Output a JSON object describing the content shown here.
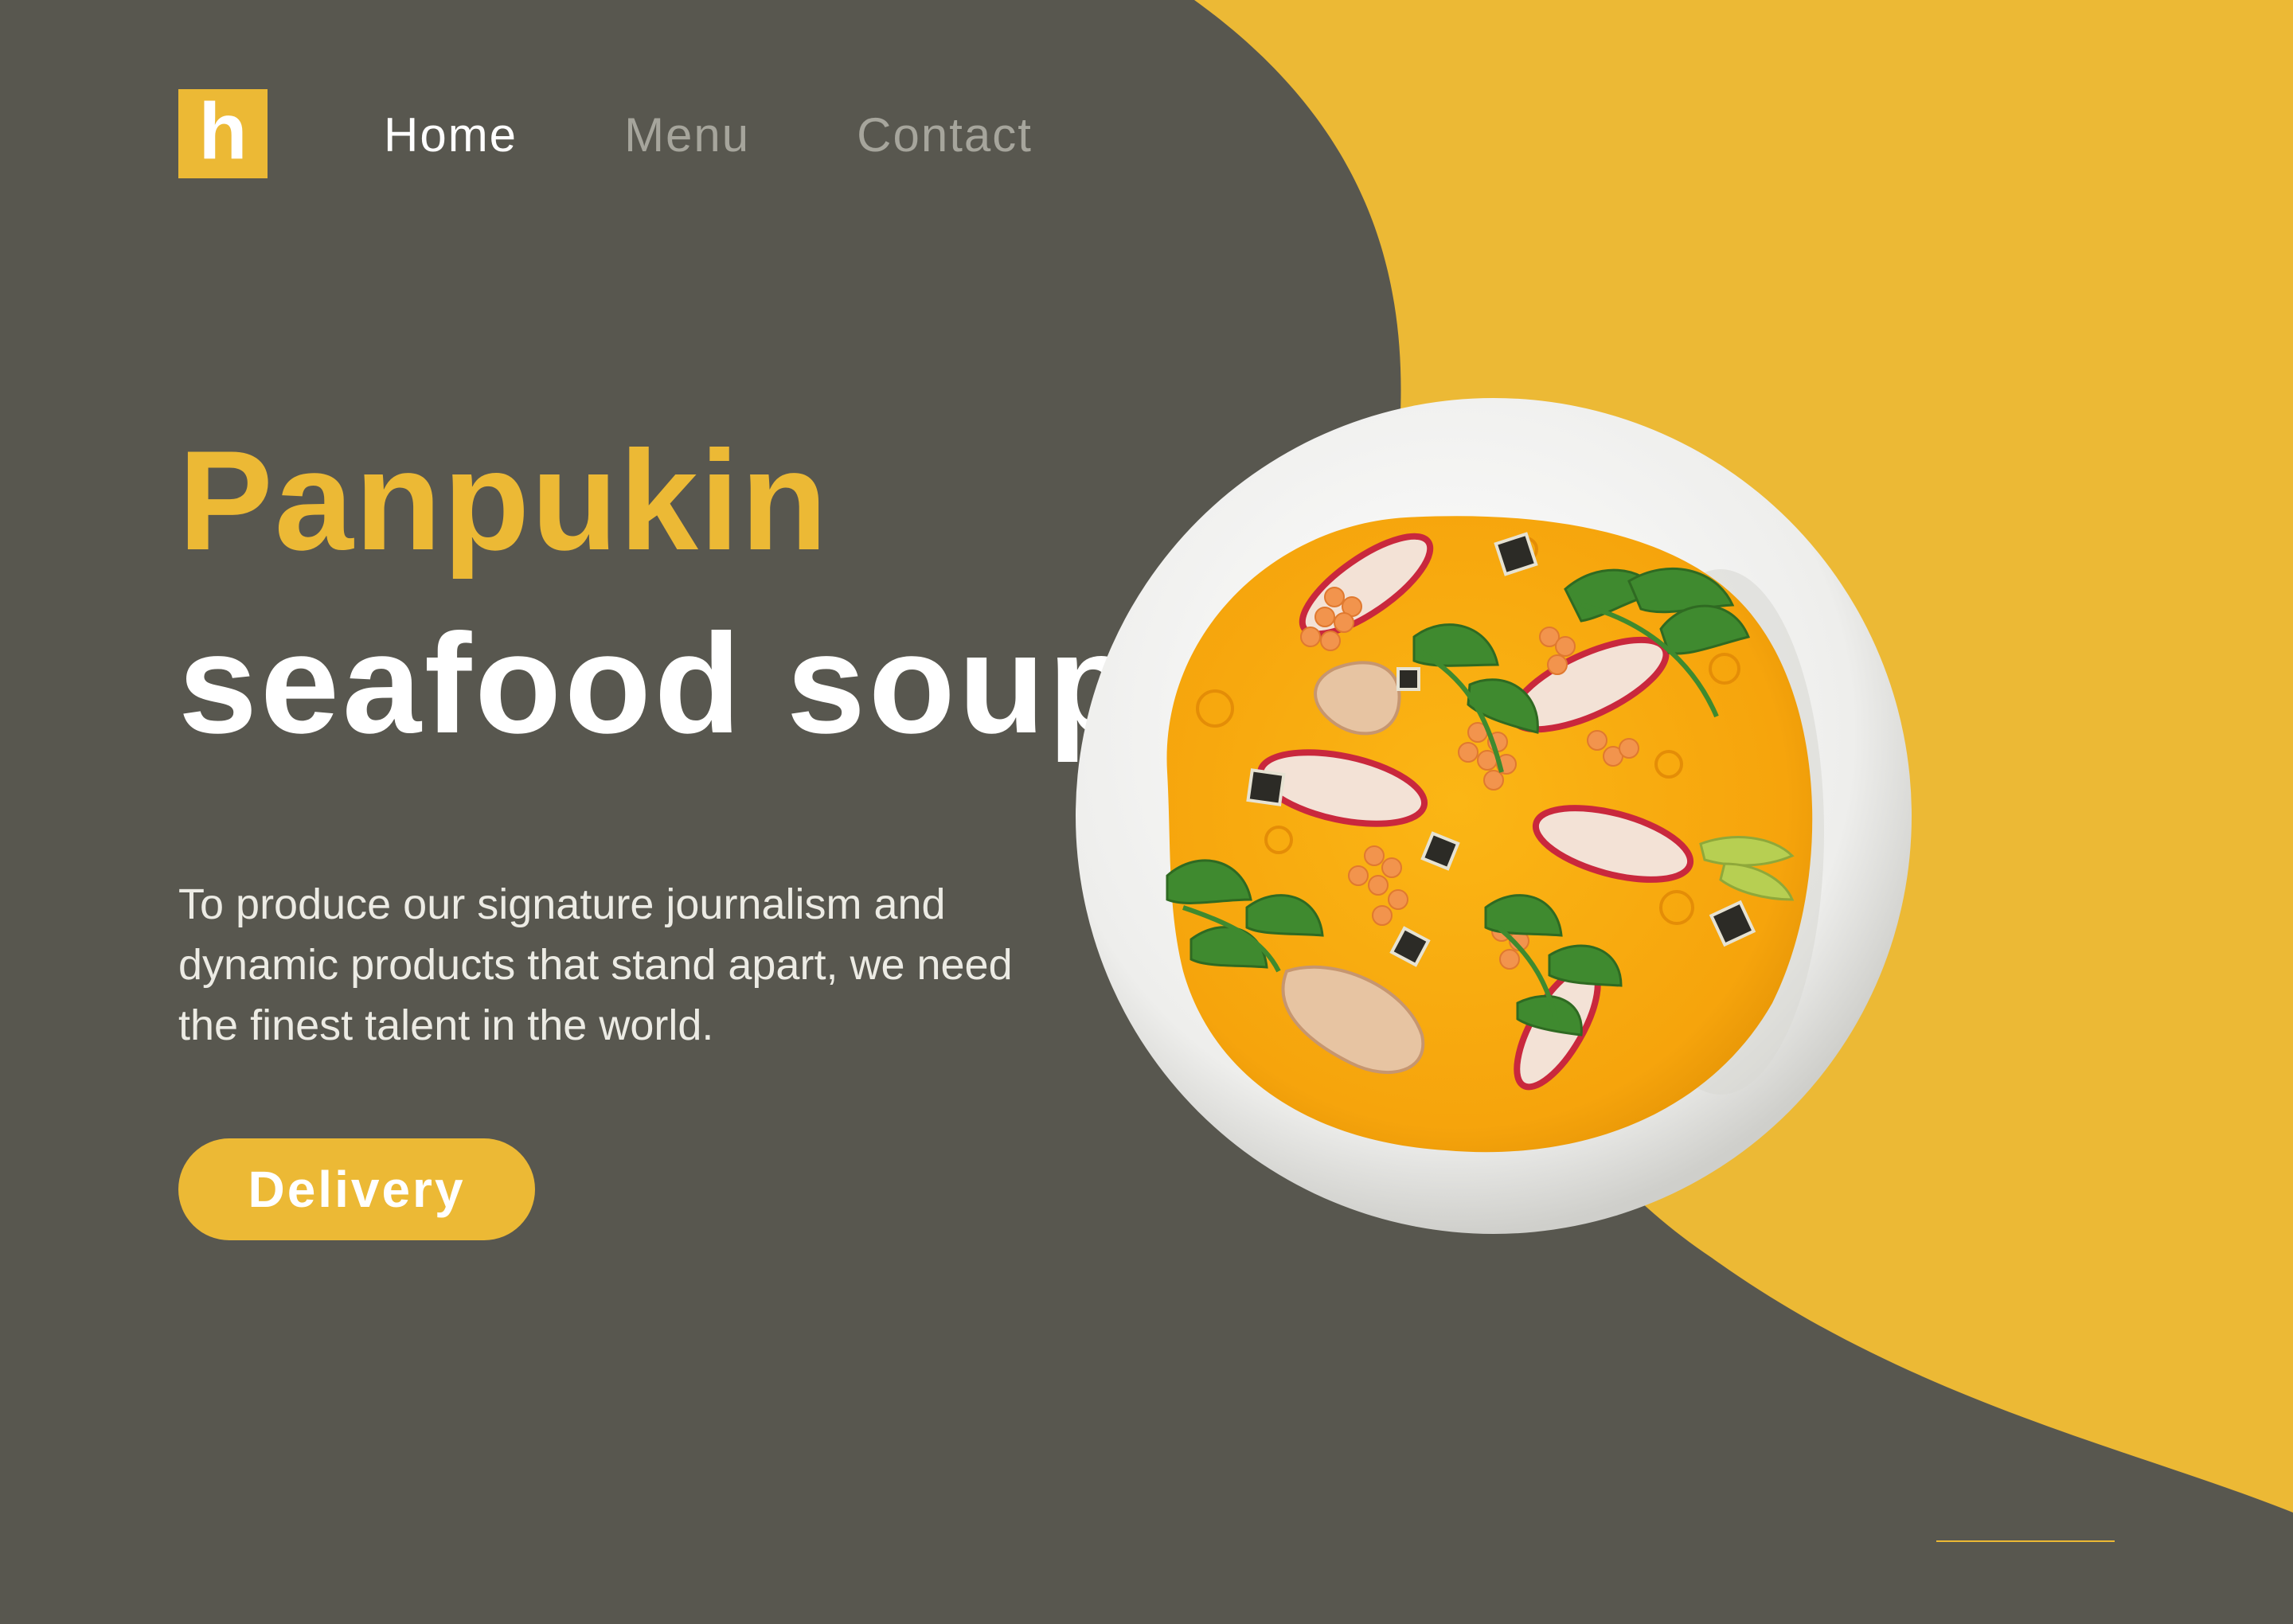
{
  "brand": {
    "logo_letter": "h"
  },
  "nav": {
    "items": [
      "Home",
      "Menu",
      "Contact"
    ],
    "active": "Home"
  },
  "hero": {
    "title_line1": "Panpukin",
    "title_line2": "seafood soup",
    "description": "To produce our signature journalism and dynamic products that stand apart, we need the finest talent in the world.",
    "cta_label": "Delivery"
  },
  "colors": {
    "background": "#58574f",
    "accent": "#ecb935",
    "text_light": "#ffffff",
    "nav_inactive": "#a6a59c"
  },
  "icons": {
    "logo": "h-logo-icon",
    "hero_image": "soup-bowl-icon"
  }
}
